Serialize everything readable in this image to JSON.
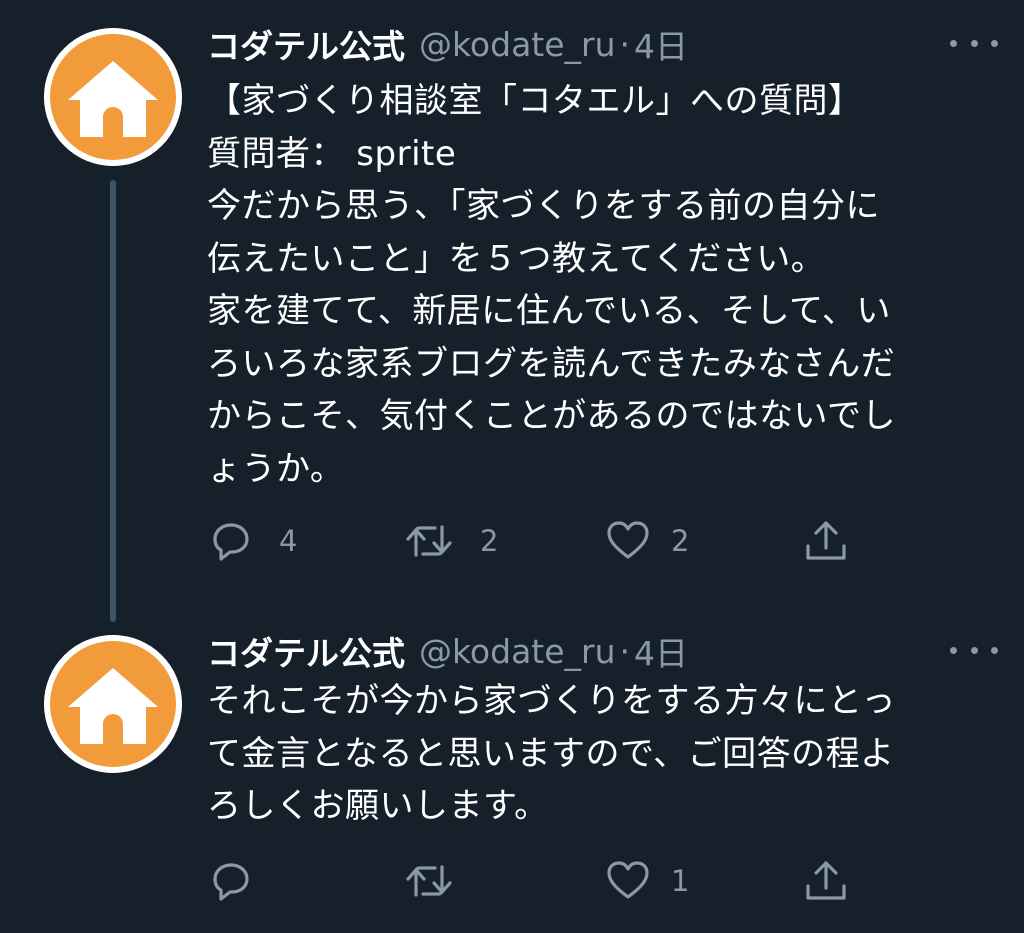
{
  "colors": {
    "background": "#15202b",
    "text": "#ffffff",
    "secondary_text": "#8b98a5",
    "thread_line": "#3d5466",
    "avatar_orange": "#f29b3a"
  },
  "tweets": [
    {
      "display_name": "コダテル公式",
      "handle": "@kodate_ru",
      "separator": "·",
      "time": "4日",
      "text": "【家づくり相談室「コタエル」への質問】\n質問者： sprite\n今だから思う、「家づくりをする前の自分に\n伝えたいこと」を５つ教えてください。\n家を建てて、新居に住んでいる、そして、い\nろいろな家系ブログを読んできたみなさんだ\nからこそ、気付くことがあるのではないでし\nょうか。",
      "replies": "4",
      "retweets": "2",
      "likes": "2",
      "icons": [
        "avatar-house-icon",
        "more-icon",
        "reply-icon",
        "retweet-icon",
        "like-icon",
        "share-icon"
      ]
    },
    {
      "display_name": "コダテル公式",
      "handle": "@kodate_ru",
      "separator": "·",
      "time": "4日",
      "text": "それこそが今から家づくりをする方々にとっ\nて金言となると思いますので、ご回答の程よ\nろしくお願いします。",
      "replies": "",
      "retweets": "",
      "likes": "1",
      "icons": [
        "avatar-house-icon",
        "more-icon",
        "reply-icon",
        "retweet-icon",
        "like-icon",
        "share-icon"
      ]
    }
  ]
}
